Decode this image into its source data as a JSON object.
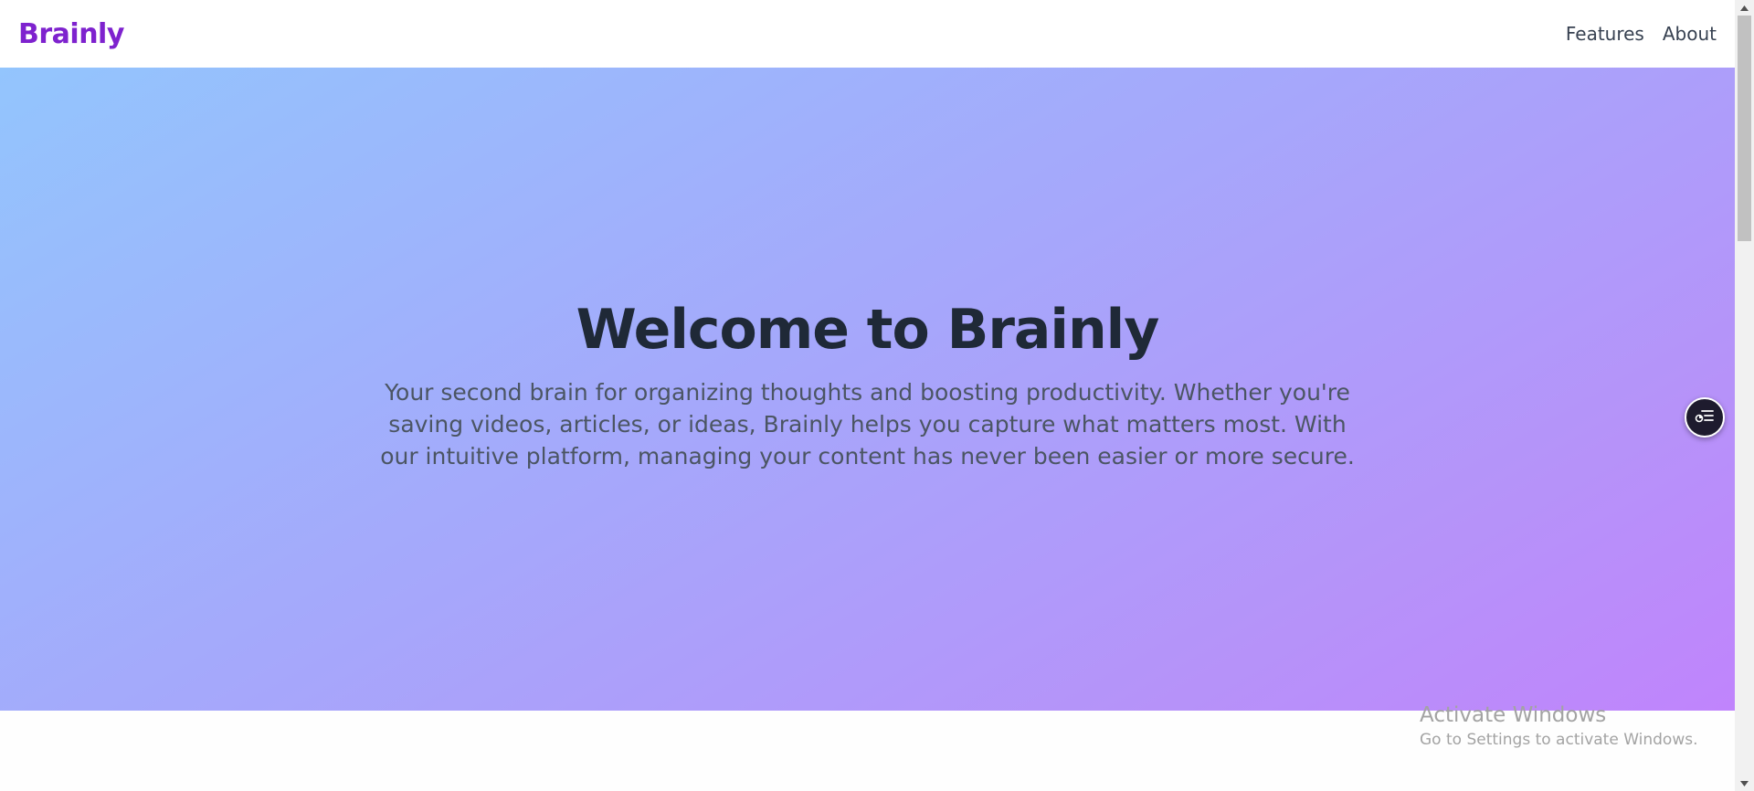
{
  "header": {
    "logo": "Brainly",
    "nav": [
      {
        "label": "Features"
      },
      {
        "label": "About"
      }
    ]
  },
  "hero": {
    "title": "Welcome to Brainly",
    "description": "Your second brain for organizing thoughts and boosting productivity. Whether you're saving videos, articles, or ideas, Brainly helps you capture what matters most. With our intuitive platform, managing your content has never been easier or more secure."
  },
  "watermark": {
    "title": "Activate Windows",
    "subtitle": "Go to Settings to activate Windows."
  },
  "colors": {
    "brand": "#7e22ce",
    "heading": "#1f2937",
    "text": "#4b5563",
    "gradient_start": "#93c5fd",
    "gradient_end": "#c084fc"
  },
  "icons": {
    "fab": "toc-list-icon"
  }
}
